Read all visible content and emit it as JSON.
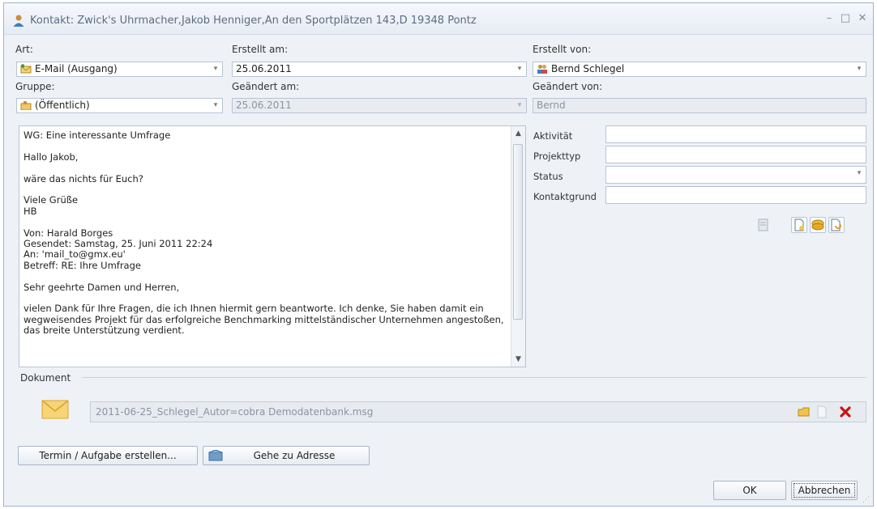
{
  "window": {
    "title": "Kontakt: Zwick's Uhrmacher,Jakob Henniger,An den Sportplätzen 143,D 19348 Pontz"
  },
  "form": {
    "art": {
      "label": "Art:",
      "value": "E-Mail (Ausgang)"
    },
    "erstellt_am": {
      "label": "Erstellt am:",
      "value": "25.06.2011"
    },
    "erstellt_von": {
      "label": "Erstellt von:",
      "value": "Bernd Schlegel"
    },
    "gruppe": {
      "label": "Gruppe:",
      "value": "(Öffentlich)"
    },
    "geaendert_am": {
      "label": "Geändert am:",
      "value": "25.06.2011"
    },
    "geaendert_von": {
      "label": "Geändert von:",
      "value": "Bernd"
    }
  },
  "memo": {
    "lines": [
      "WG: Eine interessante Umfrage",
      "",
      "Hallo Jakob,",
      "",
      "wäre das nichts für Euch?",
      "",
      "Viele Grüße",
      "HB",
      "",
      "Von: Harald Borges",
      "Gesendet: Samstag, 25. Juni 2011 22:24",
      "An: 'mail_to@gmx.eu'",
      "Betreff: RE: Ihre Umfrage",
      "",
      "Sehr geehrte Damen und Herren,",
      "",
      "vielen Dank für Ihre Fragen, die ich Ihnen hiermit gern beantworte. Ich denke, Sie haben damit ein",
      "wegweisendes Projekt für das erfolgreiche Benchmarking mittelständischer Unternehmen angestoßen,",
      "das breite Unterstützung verdient."
    ]
  },
  "props": {
    "aktivitaet": {
      "label": "Aktivität",
      "value": ""
    },
    "projekttyp": {
      "label": "Projekttyp",
      "value": ""
    },
    "status": {
      "label": "Status",
      "value": ""
    },
    "kontaktgrund": {
      "label": "Kontaktgrund",
      "value": ""
    }
  },
  "document": {
    "label": "Dokument",
    "filename": "2011-06-25_Schlegel_Autor=cobra Demodatenbank.msg"
  },
  "buttons": {
    "termin": "Termin / Aufgabe erstellen...",
    "adresse": "Gehe zu Adresse",
    "ok": "OK",
    "cancel": "Abbrechen"
  },
  "colors": {
    "accent": "#5d6c80",
    "delete": "#cc1111",
    "envelope": "#f3c24a"
  }
}
